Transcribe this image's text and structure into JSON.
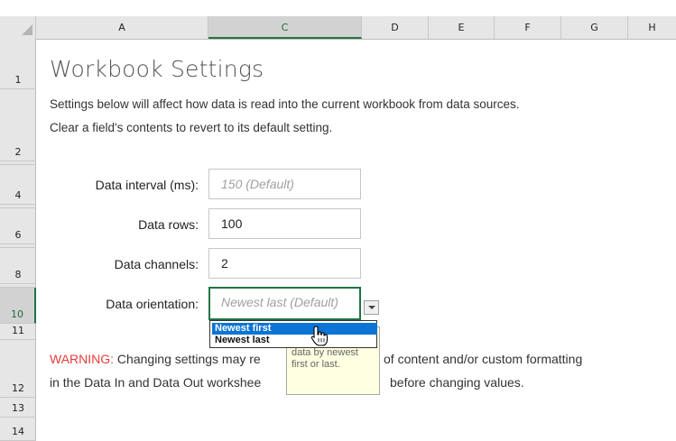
{
  "columns": [
    {
      "label": "A",
      "selected": false
    },
    {
      "label": "C",
      "selected": true
    },
    {
      "label": "D",
      "selected": false
    },
    {
      "label": "E",
      "selected": false
    },
    {
      "label": "F",
      "selected": false
    },
    {
      "label": "G",
      "selected": false
    },
    {
      "label": "H",
      "selected": false
    }
  ],
  "rows": [
    "1",
    "2",
    "4",
    "6",
    "8",
    "10",
    "11",
    "12",
    "13",
    "14"
  ],
  "title": "Workbook Settings",
  "description": {
    "line1": "Settings below will affect how data is read into the current workbook from data sources.",
    "line2": "Clear a field's contents to revert to its default setting."
  },
  "fields": {
    "interval": {
      "label": "Data interval (ms):",
      "value": "150 (Default)"
    },
    "rows": {
      "label": "Data rows:",
      "value": "100"
    },
    "channels": {
      "label": "Data channels:",
      "value": "2"
    },
    "orientation": {
      "label": "Data orientation:",
      "value": "Newest last (Default)"
    }
  },
  "dropdown": {
    "options": [
      "Newest first",
      "Newest last"
    ],
    "selected": "Newest first"
  },
  "tooltip": {
    "text": "data by newest first or last."
  },
  "warning": {
    "prefix": "WARNING:",
    "line1_a": " Changing settings may re",
    "line1_b": "of content and/or custom formatting",
    "line2_a": "in the Data In and Data Out workshee",
    "line2_b": "before changing values."
  },
  "colors": {
    "accent": "#217346",
    "warning": "#e63c3c",
    "highlight": "#0b74d4",
    "tooltip_bg": "#ffffe1"
  }
}
